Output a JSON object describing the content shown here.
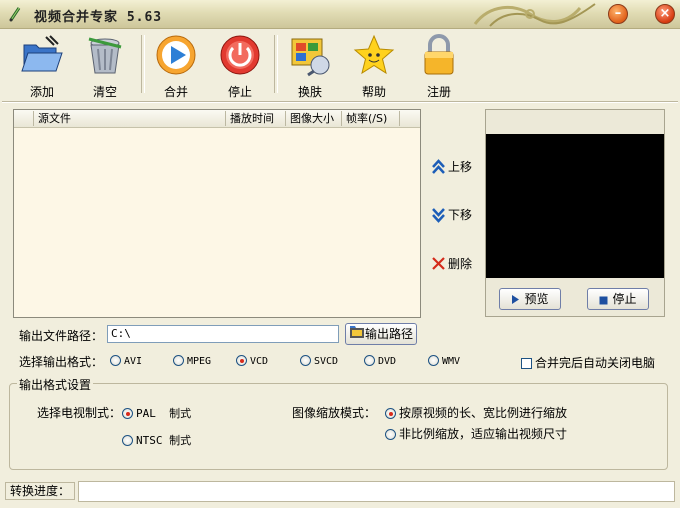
{
  "window": {
    "title": "视频合并专家 5.63",
    "minimize_label": "–",
    "close_label": "×"
  },
  "toolbar": {
    "add": "添加",
    "clear": "清空",
    "merge": "合并",
    "stop": "停止",
    "skin": "换肤",
    "help": "帮助",
    "register": "注册"
  },
  "filelist": {
    "columns": [
      "源文件",
      "播放时间",
      "图像大小",
      "帧率(/S)"
    ],
    "rows": []
  },
  "side_actions": {
    "move_up": "上移",
    "move_down": "下移",
    "delete": "删除"
  },
  "preview": {
    "play": "预览",
    "stop": "停止"
  },
  "output_path": {
    "label": "输出文件路径：",
    "value": "C:\\",
    "browse": "输出路径"
  },
  "output_format": {
    "label": "选择输出格式：",
    "options": [
      "AVI",
      "MPEG",
      "VCD",
      "SVCD",
      "DVD",
      "WMV"
    ],
    "selected": "VCD",
    "auto_shutdown": "合并完后自动关闭电脑",
    "auto_shutdown_checked": false
  },
  "settings": {
    "group_title": "输出格式设置",
    "tv_label": "选择电视制式：",
    "tv_pal": "PAL  制式",
    "tv_ntsc": "NTSC 制式",
    "tv_selected": "PAL",
    "scale_label": "图像缩放模式：",
    "scale_keep": "按原视频的长、宽比例进行缩放",
    "scale_fit": "非比例缩放，适应输出视频尺寸",
    "scale_selected": "keep"
  },
  "status": {
    "label": "转换进度：",
    "progress": 0
  },
  "colors": {
    "accent": "#1d5283",
    "selected_dot": "#d82b1c",
    "window_bg": "#f1eedd"
  }
}
